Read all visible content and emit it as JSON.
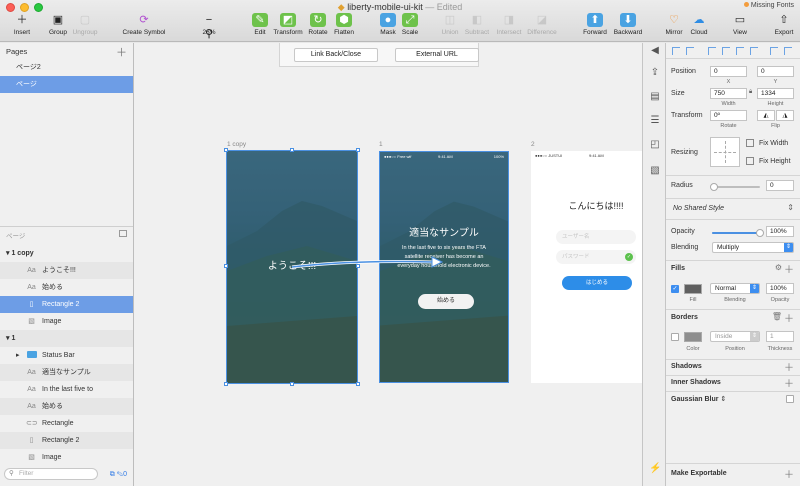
{
  "window": {
    "doc_title": "liberty-mobile-ui-kit",
    "edited": "— Edited",
    "missing_fonts": "Missing Fonts"
  },
  "toolbar": {
    "insert": "Insert",
    "group": "Group",
    "ungroup": "Ungroup",
    "create_symbol": "Create Symbol",
    "zoom": "28%",
    "edit": "Edit",
    "transform": "Transform",
    "rotate": "Rotate",
    "flatten": "Flatten",
    "mask": "Mask",
    "scale": "Scale",
    "union": "Union",
    "subtract": "Subtract",
    "intersect": "Intersect",
    "difference": "Difference",
    "forward": "Forward",
    "backward": "Backward",
    "mirror": "Mirror",
    "cloud": "Cloud",
    "view": "View",
    "export": "Export"
  },
  "pages": {
    "header": "Pages",
    "items": [
      "ページ2",
      "ページ"
    ],
    "selected_index": 1
  },
  "layers": {
    "header": "ページ",
    "filter_placeholder": "Filter",
    "groups": [
      {
        "name": "1 copy",
        "items": [
          {
            "icon": "Aa",
            "name": "ようこそ!!!"
          },
          {
            "icon": "Aa",
            "name": "始める"
          },
          {
            "icon": "rect",
            "name": "Rectangle 2",
            "selected": true
          },
          {
            "icon": "image",
            "name": "Image"
          }
        ]
      },
      {
        "name": "1",
        "items": [
          {
            "icon": "folder",
            "name": "Status Bar"
          },
          {
            "icon": "Aa",
            "name": "適当なサンプル"
          },
          {
            "icon": "Aa",
            "name": "In the last five to"
          },
          {
            "icon": "Aa",
            "name": "始める"
          },
          {
            "icon": "pill",
            "name": "Rectangle"
          },
          {
            "icon": "rect",
            "name": "Rectangle 2"
          },
          {
            "icon": "image",
            "name": "Image"
          }
        ]
      }
    ],
    "footer_count": "0"
  },
  "canvas": {
    "prototype": {
      "link_back": "Link Back/Close",
      "external_url": "External URL"
    },
    "artboards": [
      {
        "label": "1 copy",
        "welcome": "ようこそ!!!"
      },
      {
        "label": "1",
        "carrier": "●●●○○ Free wif",
        "time": "9:41 AM",
        "battery": "100%",
        "title": "適当なサンプル",
        "body": "In the last five to six years the FTA satellite receiver has become an everyday household electronic device.",
        "button": "始める"
      },
      {
        "label": "2",
        "carrier": "●●●○○ JUSTUI",
        "time": "9:41 AM",
        "greeting": "こんにちは!!!!",
        "username_placeholder": "ユーザー名",
        "password_placeholder": "パスワード",
        "button": "はじめる"
      }
    ]
  },
  "inspector": {
    "position": {
      "label": "Position",
      "x": "0",
      "y": "0",
      "x_label": "X",
      "y_label": "Y"
    },
    "size": {
      "label": "Size",
      "width": "750",
      "height": "1334",
      "w_label": "Width",
      "h_label": "Height"
    },
    "transform": {
      "label": "Transform",
      "rotate": "0º",
      "rotate_label": "Rotate",
      "flip_label": "Flip"
    },
    "resizing": {
      "label": "Resizing",
      "fix_width": "Fix Width",
      "fix_height": "Fix Height"
    },
    "radius": {
      "label": "Radius",
      "value": "0"
    },
    "shared_style": "No Shared Style",
    "opacity": {
      "label": "Opacity",
      "value": "100%",
      "level": 1.0
    },
    "blending": {
      "label": "Blending",
      "value": "Multiply"
    },
    "fills": {
      "title": "Fills",
      "color": "#5f5f5f",
      "mode": "Normal",
      "opacity": "100%",
      "fill_label": "Fill",
      "blending_label": "Blending",
      "opacity_label": "Opacity"
    },
    "borders": {
      "title": "Borders",
      "color": "#8e8e8e",
      "position": "Inside",
      "thickness": "1",
      "color_label": "Color",
      "position_label": "Position",
      "thickness_label": "Thickness"
    },
    "shadows": "Shadows",
    "inner_shadows": "Inner Shadows",
    "gaussian_blur": "Gaussian Blur",
    "make_exportable": "Make Exportable"
  },
  "colors": {
    "accent": "#4a90e2",
    "selection": "#6d9de6",
    "primary_button": "#2d8de8"
  }
}
